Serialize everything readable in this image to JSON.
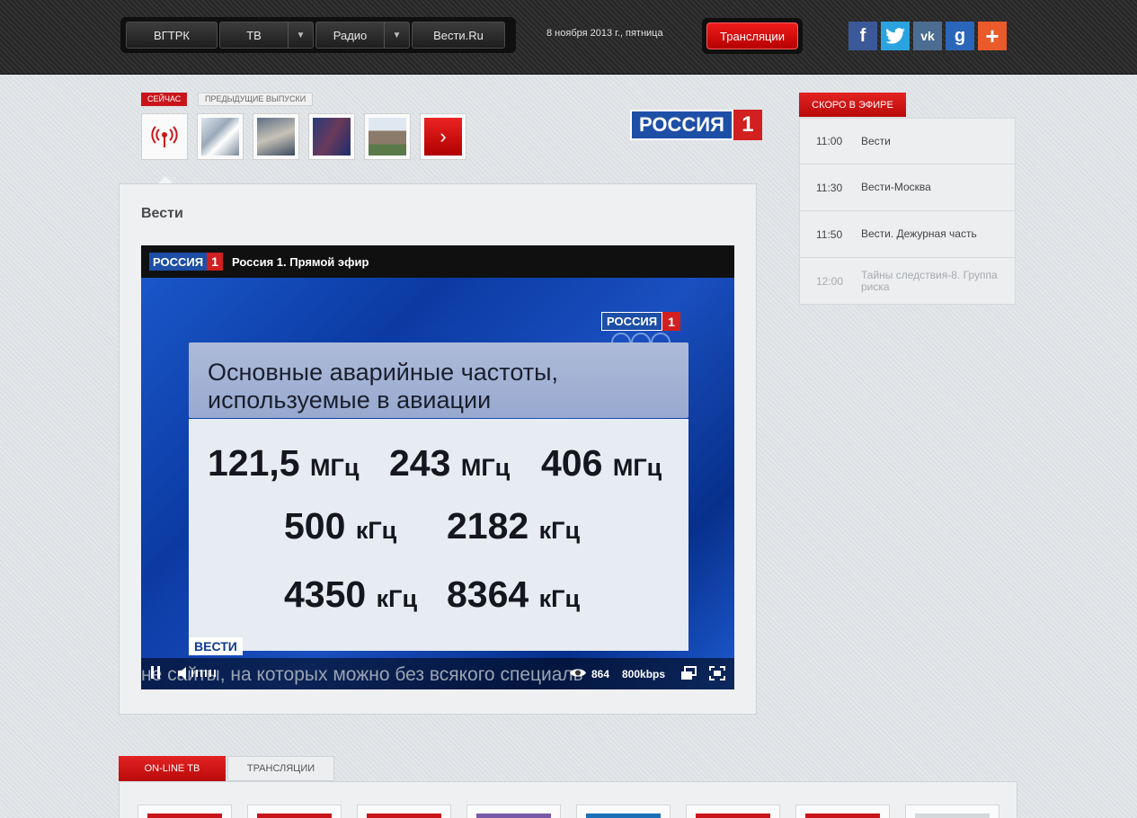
{
  "topbar": {
    "nav": [
      {
        "label": "ВГТРК",
        "dropdown": false
      },
      {
        "label": "ТВ",
        "dropdown": true
      },
      {
        "label": "Радио",
        "dropdown": true
      },
      {
        "label": "Вести.Ru",
        "dropdown": false
      }
    ],
    "date": "8 ноября 2013 г., пятница",
    "broadcast_button": "Трансляции",
    "social": [
      "facebook-icon",
      "twitter-icon",
      "vk-icon",
      "google-plus-icon",
      "share-plus-icon"
    ]
  },
  "episodes": {
    "tab_now": "СЕЙЧАС",
    "tab_prev": "ПРЕДЫДУЩИЕ ВЫПУСКИ"
  },
  "channel_logo": {
    "name": "РОССИЯ",
    "number": "1"
  },
  "main": {
    "title": "Вести",
    "player": {
      "logo_name": "РОССИЯ",
      "logo_number": "1",
      "stream_title": "Россия 1. Прямой эфир",
      "slide_heading_line1": "Основные аварийные частоты,",
      "slide_heading_line2": "используемые в авиации",
      "frequencies": [
        {
          "value": "121,5",
          "unit": "МГц"
        },
        {
          "value": "243",
          "unit": "МГц"
        },
        {
          "value": "406",
          "unit": "МГц"
        },
        {
          "value": "500",
          "unit": "кГц"
        },
        {
          "value": "2182",
          "unit": "кГц"
        },
        {
          "value": "4350",
          "unit": "кГц"
        },
        {
          "value": "8364",
          "unit": "кГц"
        }
      ],
      "program_tag": "ВЕСТИ",
      "ticker": "не сайты, на которых можно без всякого специаль",
      "viewers": "864",
      "bitrate": "800kbps"
    }
  },
  "schedule": {
    "tab": "СКОРО В ЭФИРЕ",
    "items": [
      {
        "time": "11:00",
        "title": "Вести"
      },
      {
        "time": "11:30",
        "title": "Вести-Москва"
      },
      {
        "time": "11:50",
        "title": "Вести. Дежурная часть"
      },
      {
        "time": "12:00",
        "title": "Тайны следствия-8. Группа риска"
      }
    ]
  },
  "bottom": {
    "tab_online": "ON-LINE ТВ",
    "tab_broadcasts": "ТРАНСЛЯЦИИ"
  },
  "colors": {
    "accent_red": "#c8151b",
    "rossia_blue": "#1d4fa6"
  }
}
